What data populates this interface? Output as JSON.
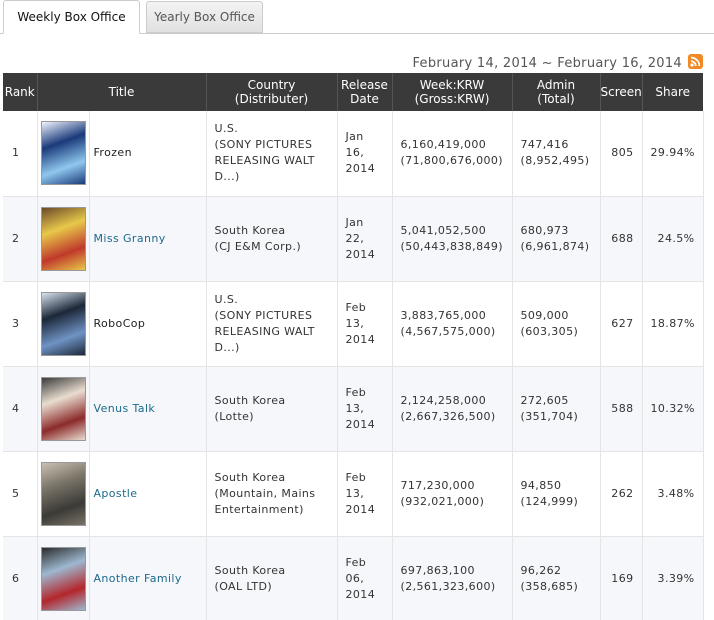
{
  "tabs": [
    {
      "label": "Weekly Box Office",
      "active": true
    },
    {
      "label": "Yearly Box Office",
      "active": false
    }
  ],
  "date_range": "February 14, 2014 ~ February 16, 2014",
  "rss_icon": "rss-feed-icon",
  "columns": [
    "Rank",
    "Title",
    "Country\n(Distributer)",
    "Release\nDate",
    "Week:KRW\n(Gross:KRW)",
    "Admin\n(Total)",
    "Screen",
    "Share"
  ],
  "rows": [
    {
      "rank": "1",
      "title": "Frozen",
      "title_link": false,
      "country": "U.S.\n(SONY PICTURES\nRELEASING WALT\nD...)",
      "release": "Jan\n16,\n2014",
      "week": "6,160,419,000\n(71,800,676,000)",
      "admin": "747,416\n(8,952,495)",
      "screen": "805",
      "share": "29.94%",
      "poster": {
        "bg": "#1a3a7a",
        "accent": "#8fc7ee",
        "accent2": "#f0f4ff"
      }
    },
    {
      "rank": "2",
      "title": "Miss Granny",
      "title_link": true,
      "country": "South Korea\n(CJ E&M Corp.)",
      "release": "Jan\n22,\n2014",
      "week": "5,041,052,500\n(50,443,838,849)",
      "admin": "680,973\n(6,961,874)",
      "screen": "688",
      "share": "24.5%",
      "poster": {
        "bg": "#e8c84a",
        "accent": "#c0392b",
        "accent2": "#6b4a2a"
      }
    },
    {
      "rank": "3",
      "title": "RoboCop",
      "title_link": false,
      "country": "U.S.\n(SONY PICTURES\nRELEASING WALT\nD...)",
      "release": "Feb\n13,\n2014",
      "week": "3,883,765,000\n(4,567,575,000)",
      "admin": "509,000\n(603,305)",
      "screen": "627",
      "share": "18.87%",
      "poster": {
        "bg": "#1c2738",
        "accent": "#6f93c4",
        "accent2": "#d9e3f0"
      }
    },
    {
      "rank": "4",
      "title": "Venus Talk",
      "title_link": true,
      "country": "South Korea\n(Lotte)",
      "release": "Feb\n13,\n2014",
      "week": "2,124,258,000\n(2,667,326,500)",
      "admin": "272,605\n(351,704)",
      "screen": "588",
      "share": "10.32%",
      "poster": {
        "bg": "#e9ddd0",
        "accent": "#8b2b2b",
        "accent2": "#3a3a3a"
      }
    },
    {
      "rank": "5",
      "title": "Apostle",
      "title_link": true,
      "country": "South Korea\n(Mountain, Mains\nEntertainment)",
      "release": "Feb\n13,\n2014",
      "week": "717,230,000\n(932,021,000)",
      "admin": "94,850\n(124,999)",
      "screen": "262",
      "share": "3.48%",
      "poster": {
        "bg": "#7a7468",
        "accent": "#3b3a36",
        "accent2": "#c9c2b3"
      }
    },
    {
      "rank": "6",
      "title": "Another Family",
      "title_link": true,
      "country": "South Korea\n(OAL LTD)",
      "release": "Feb\n06,\n2014",
      "week": "697,863,100\n(2,561,323,600)",
      "admin": "96,262\n(358,685)",
      "screen": "169",
      "share": "3.39%",
      "poster": {
        "bg": "#9db8d0",
        "accent": "#b3262b",
        "accent2": "#2b2b2b"
      }
    }
  ]
}
